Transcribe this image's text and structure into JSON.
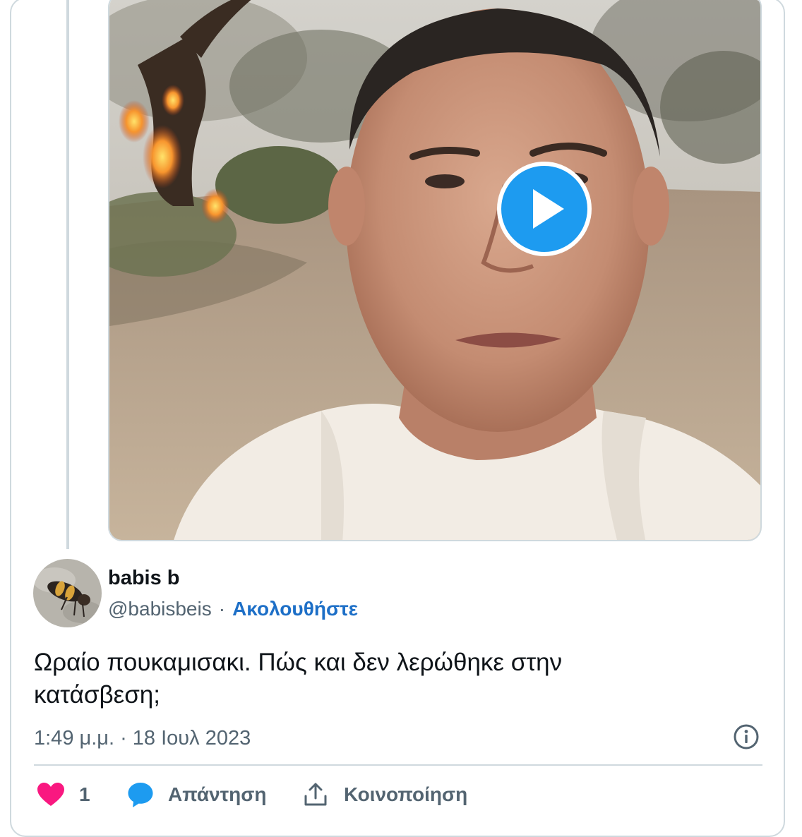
{
  "tweet": {
    "media": {
      "type": "video",
      "play_icon": "play-circle-icon"
    },
    "author": {
      "display_name": "babis b",
      "handle": "@babisbeis",
      "separator": "·",
      "follow_label": "Ακολουθήστε",
      "avatar_icon": "bee-avatar"
    },
    "text_line1": "Ωραίο πουκαμισακι. Πώς και δεν λερώθηκε στην",
    "text_line2": "κατάσβεση;",
    "timestamp": "1:49 μ.μ. · 18 Ιουλ 2023",
    "info_icon": "info-icon",
    "actions": {
      "like_icon": "heart-icon",
      "like_count": "1",
      "reply_icon": "speech-bubble-icon",
      "reply_label": "Απάντηση",
      "share_icon": "share-icon",
      "share_label": "Κοινοποίηση"
    }
  },
  "colors": {
    "accent_blue": "#1d9bf0",
    "link_blue": "#1d6fc7",
    "heart_pink": "#f91880",
    "secondary_text": "#536471",
    "border": "#cfd9de"
  }
}
